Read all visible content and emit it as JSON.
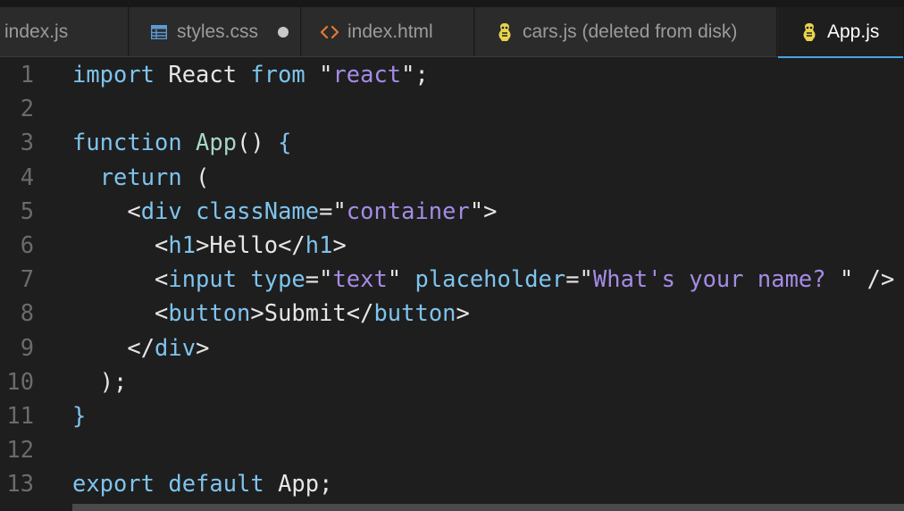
{
  "tabs": [
    {
      "label": "index.js",
      "icon": "none",
      "active": false
    },
    {
      "label": "styles.css",
      "icon": "css-file-icon",
      "active": false,
      "dirty": true
    },
    {
      "label": "index.html",
      "icon": "html-file-icon",
      "active": false
    },
    {
      "label": "cars.js (deleted from disk)",
      "icon": "javascript-file-icon",
      "active": false
    },
    {
      "label": "App.js",
      "icon": "javascript-file-icon",
      "active": true
    }
  ],
  "colors": {
    "background": "#1e1e1e",
    "keyword": "#7fc4ee",
    "function_name": "#a6d7c6",
    "string": "#a58be6",
    "plain": "#e6e6e6",
    "line_number": "#6b6b6b",
    "active_tab_accent": "#4aa3e0"
  },
  "code": {
    "line_numbers": [
      "1",
      "2",
      "3",
      "4",
      "5",
      "6",
      "7",
      "8",
      "9",
      "10",
      "11",
      "12",
      "13"
    ],
    "l1": {
      "import": "import",
      "react_ident": "React",
      "from": "from",
      "q1": "\"",
      "module": "react",
      "q2": "\";"
    },
    "l3": {
      "function": "function",
      "name": "App",
      "parens": "()",
      "brace": "{"
    },
    "l4": {
      "return": "return",
      "paren": "("
    },
    "l5": {
      "open": "<",
      "tag": "div",
      "attr": "className",
      "eq": "=",
      "q1": "\"",
      "value": "container",
      "q2": "\"",
      "close": ">"
    },
    "l6": {
      "open": "<",
      "tag": "h1",
      "close": ">",
      "text": "Hello",
      "end_open": "</",
      "end_tag": "h1",
      "end_close": ">"
    },
    "l7": {
      "open": "<",
      "tag": "input",
      "attr1": "type",
      "eq1": "=",
      "q1": "\"",
      "value1": "text",
      "q2": "\"",
      "attr2": "placeholder",
      "eq2": "=",
      "q3": "\"",
      "value2": "What's your name? ",
      "q4": "\"",
      "self_close": "/>"
    },
    "l8": {
      "open": "<",
      "tag": "button",
      "close": ">",
      "text": "Submit",
      "end_open": "</",
      "end_tag": "button",
      "end_close": ">"
    },
    "l9": {
      "end_open": "</",
      "end_tag": "div",
      "end_close": ">"
    },
    "l10": {
      "text": ");"
    },
    "l11": {
      "text": "}"
    },
    "l13": {
      "export": "export",
      "default": "default",
      "name": "App",
      "semi": ";"
    }
  }
}
